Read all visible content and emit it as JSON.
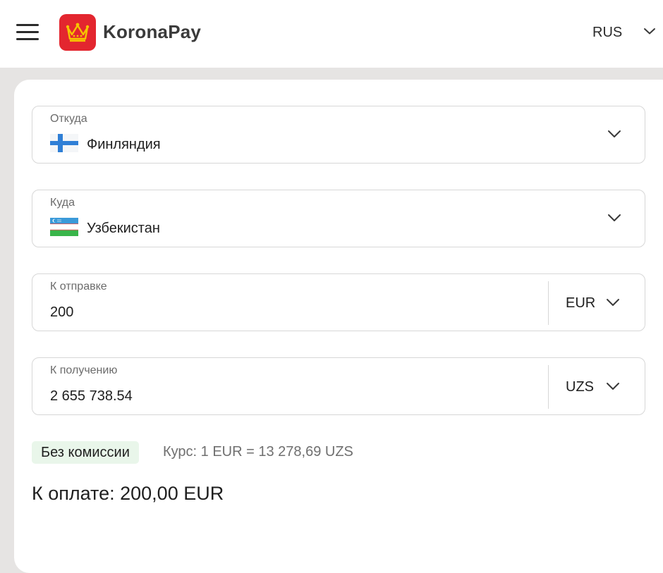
{
  "header": {
    "brand": "KoronaPay",
    "language": "RUS",
    "icons": {
      "menu": "hamburger-icon",
      "logo": "crown-icon",
      "language_dropdown": "chevron-down-icon"
    },
    "colors": {
      "logo_bg": "#e3262f",
      "logo_crown": "#f6c500"
    }
  },
  "form": {
    "from": {
      "label": "Откуда",
      "value": "Финляндия",
      "flag": "finland-flag-icon"
    },
    "to": {
      "label": "Куда",
      "value": "Узбекистан",
      "flag": "uzbekistan-flag-icon"
    },
    "send": {
      "label": "К отправке",
      "value": "200",
      "currency": "EUR"
    },
    "receive": {
      "label": "К получению",
      "value": "2 655 738.54",
      "currency": "UZS"
    }
  },
  "summary": {
    "commission_badge": "Без комиссии",
    "rate": "Курс: 1 EUR = 13 278,69 UZS",
    "total": "К оплате: 200,00 EUR"
  }
}
